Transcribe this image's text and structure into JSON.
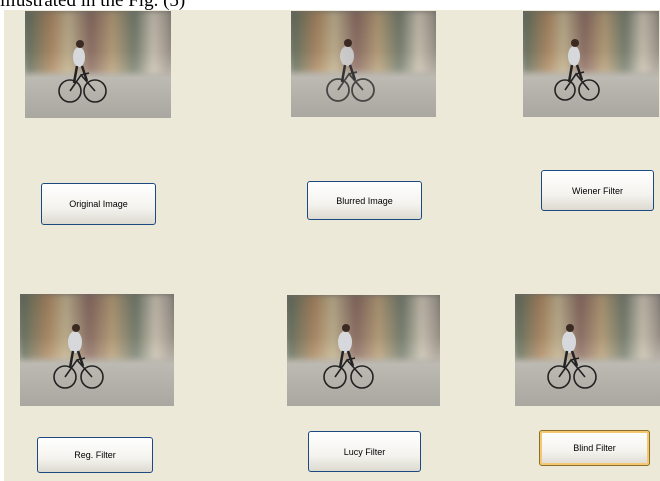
{
  "caption": "illustrated in the Fig. (5)",
  "images": [
    {
      "name": "original-image-thumbnail"
    },
    {
      "name": "blurred-image-thumbnail"
    },
    {
      "name": "wiener-filter-image-thumbnail"
    },
    {
      "name": "reg-filter-image-thumbnail"
    },
    {
      "name": "lucy-filter-image-thumbnail"
    },
    {
      "name": "blind-filter-image-thumbnail"
    }
  ],
  "buttons": {
    "original": "Original Image",
    "blurred": "Blurred Image",
    "wiener": "Wiener Filter",
    "reg": "Reg. Filter",
    "lucy": "Lucy Filter",
    "blind": "Blind Filter"
  },
  "colors": {
    "panel_background": "#ece9d8",
    "button_border": "#1c4a80",
    "focus_ring": "#f3c871"
  }
}
